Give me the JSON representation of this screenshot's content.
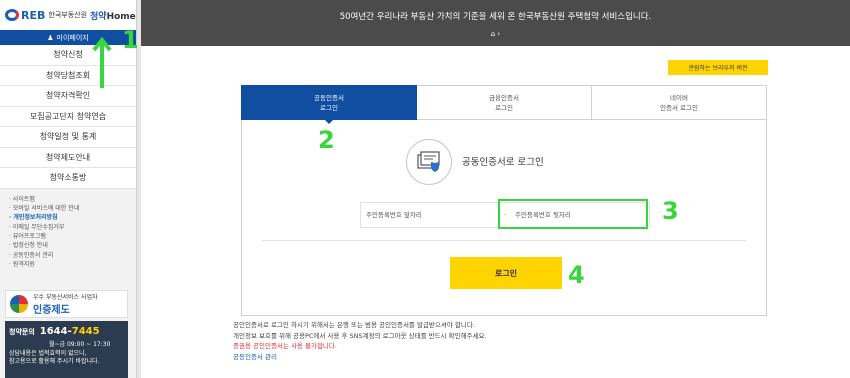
{
  "sidebar": {
    "logo_reb": "REB",
    "logo_org": "한국부동산원",
    "logo_home_a": "청약",
    "logo_home_b": "Home",
    "mypage": "마이페이지",
    "menu": [
      "청약신청",
      "청약당첨조회",
      "청약자격확인",
      "모집공고단지 청약연습",
      "청약일정 및 통계",
      "청약제도안내",
      "청약소통방"
    ],
    "sub": [
      "· 사이트맵",
      "· 모바일 서비스에 대한 안내",
      "· 개인정보처리방침",
      "· 이메일 무단수집거부",
      "· 뷰어프로그램",
      "· 법정신청 안내",
      "· 공동인증서 관리",
      "· 원격지원"
    ],
    "cert_banner_top": "우수 부동산서비스 사업자",
    "cert_banner_big": "인증제도",
    "hotline_label": "청약문의",
    "hotline_num_a": "1644-",
    "hotline_num_b": "7445",
    "hotline_hours": "월~금 09:00 ~ 17:30",
    "hotline_note_1": "상담내용은 법적효력이 없으니,",
    "hotline_note_2": "참고용으로 활용해 주시기 바랍니다."
  },
  "main": {
    "hero_title": "50여년간 우리나라 부동산 가치의 기준을 세워 온 한국부동산원 주택청약 서비스입니다.",
    "breadcrumb": "⌂  ›",
    "pdf_button": "관람하는 브라우저 버전",
    "tabs": [
      {
        "line1": "공동인증서",
        "line2": "로그인",
        "active": true
      },
      {
        "line1": "금융인증서",
        "line2": "로그인",
        "active": false
      },
      {
        "line1": "네이버",
        "line2": "인증서 로그인",
        "active": false
      }
    ],
    "cert_title": "공동인증서로 로그인",
    "id_front_placeholder": "주민등록번호 앞자리",
    "id_back_placeholder": "주민등록번호 뒷자리",
    "id_sep": "-",
    "login_button": "로그인",
    "note_1": "공인인증서로 로그인 하시기 위해서는 은행 또는 범용 공인인증서를 발급받으셔야 합니다.",
    "note_2": "개인정보 보호를 위해 공용PC에서 사용 후 SNS계정의 로그아웃 상태를 반드시 확인해주세요.",
    "note_warn": "증권용 공인인증서는 사용 불가합니다.",
    "note_link": "공동인증서 관리"
  },
  "annotations": {
    "n1": "1",
    "n2": "2",
    "n3": "3",
    "n4": "4",
    "color": "#39d53c"
  },
  "colors": {
    "brand": "#0f4ea0",
    "accent": "#ffd400",
    "hero": "#4b4b4b"
  }
}
